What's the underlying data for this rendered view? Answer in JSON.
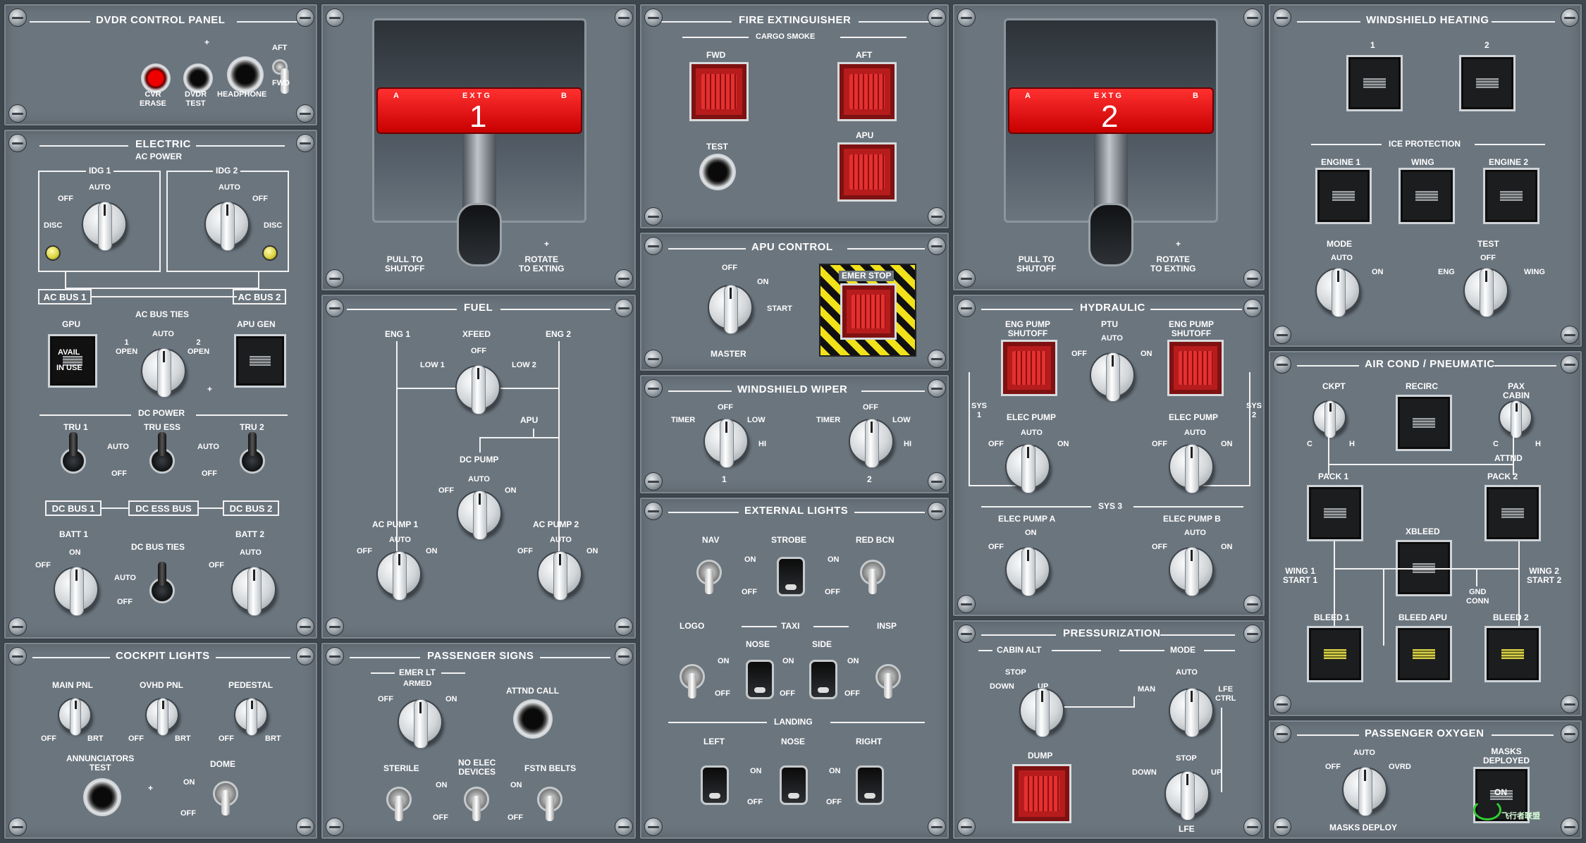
{
  "dvdr": {
    "title": "DVDR CONTROL PANEL",
    "cvr_erase": "CVR\nERASE",
    "dvdr_test": "DVDR\nTEST",
    "headphone": "HEADPHONE",
    "aft": "AFT",
    "fwd": "FWD",
    "plus": "+"
  },
  "extg1": {
    "label": "EXTG",
    "number": "1",
    "a": "A",
    "b": "B",
    "pull": "PULL TO\nSHUTOFF",
    "rotate": "ROTATE\nTO EXTING",
    "plus": "+"
  },
  "extg2": {
    "label": "EXTG",
    "number": "2",
    "a": "A",
    "b": "B",
    "pull": "PULL TO\nSHUTOFF",
    "rotate": "ROTATE\nTO EXTING",
    "plus": "+"
  },
  "fire": {
    "title": "FIRE EXTINGUISHER",
    "sub": "CARGO SMOKE",
    "fwd": "FWD",
    "aft": "AFT",
    "apu": "APU",
    "test": "TEST"
  },
  "electric": {
    "title": "ELECTRIC",
    "ac_power": "AC POWER",
    "idg1": "IDG 1",
    "idg2": "IDG 2",
    "off": "OFF",
    "auto": "AUTO",
    "disc": "DISC",
    "ac_bus1": "AC BUS 1",
    "ac_bus2": "AC BUS 2",
    "gpu": "GPU",
    "avail": "AVAIL",
    "in_use": "IN USE",
    "ac_bus_ties": "AC BUS TIES",
    "apu_gen": "APU GEN",
    "one_open": "1\nOPEN",
    "two_open": "2\nOPEN",
    "plus": "+",
    "dc_power": "DC POWER",
    "tru1": "TRU 1",
    "tru_ess": "TRU ESS",
    "tru2": "TRU 2",
    "on": "ON",
    "dc_bus1": "DC BUS 1",
    "dc_ess_bus": "DC ESS BUS",
    "dc_bus2": "DC BUS 2",
    "batt1": "BATT 1",
    "batt2": "BATT 2",
    "dc_bus_ties": "DC BUS TIES"
  },
  "fuel": {
    "title": "FUEL",
    "eng1": "ENG 1",
    "xfeed": "XFEED",
    "eng2": "ENG 2",
    "off": "OFF",
    "low1": "LOW 1",
    "low2": "LOW 2",
    "apu": "APU",
    "dc_pump": "DC PUMP",
    "auto": "AUTO",
    "on": "ON",
    "ac_pump1": "AC PUMP 1",
    "ac_pump2": "AC PUMP 2"
  },
  "apu_control": {
    "title": "APU CONTROL",
    "off": "OFF",
    "on": "ON",
    "start": "START",
    "master": "MASTER",
    "emer_stop": "EMER STOP"
  },
  "wiper": {
    "title": "WINDSHIELD WIPER",
    "timer": "TIMER",
    "off": "OFF",
    "low": "LOW",
    "hi": "HI",
    "one": "1",
    "two": "2"
  },
  "ext_lights": {
    "title": "EXTERNAL LIGHTS",
    "nav": "NAV",
    "strobe": "STROBE",
    "red_bcn": "RED BCN",
    "on": "ON",
    "off": "OFF",
    "logo": "LOGO",
    "taxi": "TAXI",
    "insp": "INSP",
    "nose": "NOSE",
    "side": "SIDE",
    "landing": "LANDING",
    "left": "LEFT",
    "right": "RIGHT"
  },
  "hydraulic": {
    "title": "HYDRAULIC",
    "eng_pump_shutoff": "ENG PUMP\nSHUTOFF",
    "ptu": "PTU",
    "auto": "AUTO",
    "off": "OFF",
    "on": "ON",
    "sys1": "SYS\n1",
    "sys2": "SYS\n2",
    "elec_pump": "ELEC PUMP",
    "sys3": "SYS 3",
    "elec_pump_a": "ELEC PUMP A",
    "elec_pump_b": "ELEC PUMP B"
  },
  "pressurization": {
    "title": "PRESSURIZATION",
    "cabin_alt": "CABIN ALT",
    "mode": "MODE",
    "stop": "STOP",
    "down": "DOWN",
    "up": "UP",
    "man": "MAN",
    "auto": "AUTO",
    "lfe_ctrl": "LFE\nCTRL",
    "dump": "DUMP",
    "lfe": "LFE"
  },
  "windshield_heating": {
    "title": "WINDSHIELD HEATING",
    "one": "1",
    "two": "2",
    "ice_protection": "ICE PROTECTION",
    "engine1": "ENGINE 1",
    "wing": "WING",
    "engine2": "ENGINE 2",
    "mode": "MODE",
    "test": "TEST",
    "auto": "AUTO",
    "on": "ON",
    "eng": "ENG",
    "off": "OFF"
  },
  "air_cond": {
    "title": "AIR COND / PNEUMATIC",
    "ckpt": "CKPT",
    "recirc": "RECIRC",
    "pax_cabin": "PAX\nCABIN",
    "c": "C",
    "h": "H",
    "attnd": "ATTND",
    "pack1": "PACK 1",
    "pack2": "PACK 2",
    "xbleed": "XBLEED",
    "wing1_start1": "WING 1\nSTART 1",
    "wing2_start2": "WING 2\nSTART 2",
    "gnd_conn": "GND\nCONN",
    "bleed1": "BLEED 1",
    "bleed_apu": "BLEED APU",
    "bleed2": "BLEED 2"
  },
  "cockpit_lights": {
    "title": "COCKPIT LIGHTS",
    "main_pnl": "MAIN PNL",
    "ovhd_pnl": "OVHD PNL",
    "pedestal": "PEDESTAL",
    "off": "OFF",
    "brt": "BRT",
    "annunciators_test": "ANNUNCIATORS\nTEST",
    "dome": "DOME",
    "on": "ON",
    "plus": "+"
  },
  "passenger_signs": {
    "title": "PASSENGER SIGNS",
    "emer_lt": "EMER LT",
    "armed": "ARMED",
    "off": "OFF",
    "on": "ON",
    "attnd_call": "ATTND CALL",
    "sterile": "STERILE",
    "no_elec": "NO ELEC\nDEVICES",
    "fstn_belts": "FSTN BELTS"
  },
  "passenger_oxygen": {
    "title": "PASSENGER OXYGEN",
    "auto": "AUTO",
    "off": "OFF",
    "ovrd": "OVRD",
    "masks_deploy": "MASKS DEPLOY",
    "masks_deployed": "MASKS\nDEPLOYED",
    "on": "ON"
  },
  "colors": {
    "panel": "#6b757e",
    "handle_red": "#e00000",
    "guard_red": "#b71c1c",
    "annunciator_yellow": "#d8d24a"
  },
  "watermark": "飞行者联盟"
}
